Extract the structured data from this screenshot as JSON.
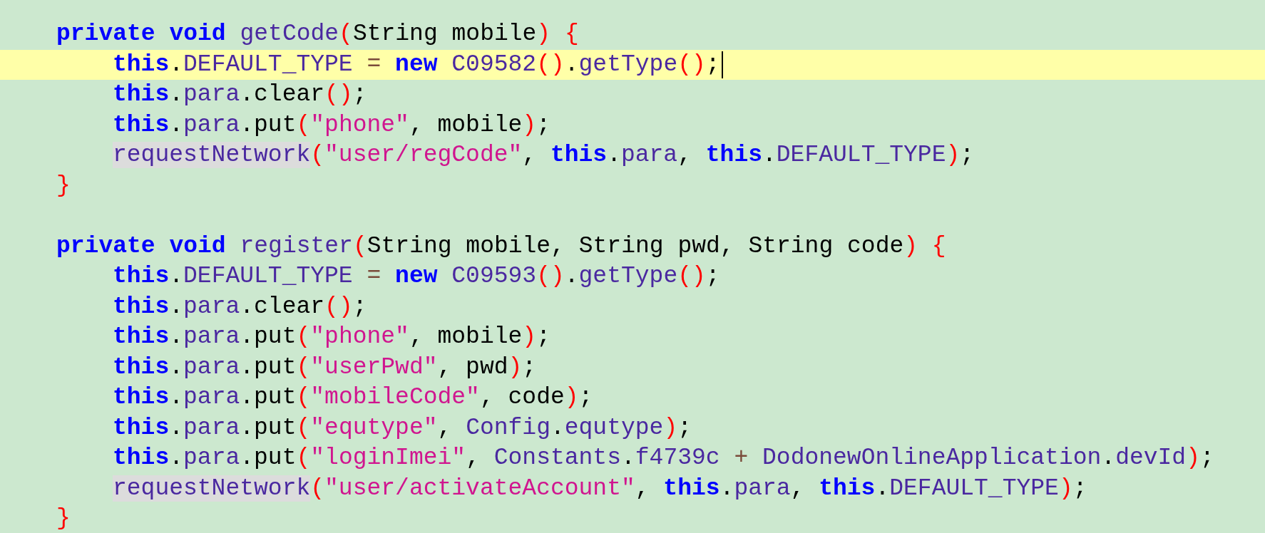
{
  "editor": {
    "methods": [
      {
        "signature": {
          "current": false,
          "tokens": [
            {
              "kind": "keyword",
              "text": "private "
            },
            {
              "kind": "keyword",
              "text": "void "
            },
            {
              "kind": "member",
              "text": "getCode"
            },
            {
              "kind": "paren",
              "text": "("
            },
            {
              "kind": "plain",
              "text": "String mobile"
            },
            {
              "kind": "paren",
              "text": ")"
            },
            {
              "kind": "paren",
              "text": " {"
            }
          ]
        },
        "body": [
          {
            "current": true,
            "tokens": [
              {
                "kind": "keyword",
                "text": "this"
              },
              {
                "kind": "plain",
                "text": "."
              },
              {
                "kind": "member",
                "text": "DEFAULT_TYPE"
              },
              {
                "kind": "operator",
                "text": " = "
              },
              {
                "kind": "keyword",
                "text": "new "
              },
              {
                "kind": "member",
                "text": "C09582"
              },
              {
                "kind": "paren",
                "text": "()"
              },
              {
                "kind": "plain",
                "text": "."
              },
              {
                "kind": "member",
                "text": "getType"
              },
              {
                "kind": "paren",
                "text": "()"
              },
              {
                "kind": "plain",
                "text": ";"
              }
            ]
          },
          {
            "current": false,
            "tokens": [
              {
                "kind": "keyword",
                "text": "this"
              },
              {
                "kind": "plain",
                "text": "."
              },
              {
                "kind": "member",
                "text": "para"
              },
              {
                "kind": "plain",
                "text": ".clear"
              },
              {
                "kind": "paren",
                "text": "()"
              },
              {
                "kind": "plain",
                "text": ";"
              }
            ]
          },
          {
            "current": false,
            "tokens": [
              {
                "kind": "keyword",
                "text": "this"
              },
              {
                "kind": "plain",
                "text": "."
              },
              {
                "kind": "member",
                "text": "para"
              },
              {
                "kind": "plain",
                "text": ".put"
              },
              {
                "kind": "paren",
                "text": "("
              },
              {
                "kind": "string",
                "text": "\"phone\""
              },
              {
                "kind": "plain",
                "text": ", mobile"
              },
              {
                "kind": "paren",
                "text": ")"
              },
              {
                "kind": "plain",
                "text": ";"
              }
            ]
          },
          {
            "current": false,
            "tokens": [
              {
                "kind": "reference",
                "text": "requestNetwork"
              },
              {
                "kind": "paren",
                "text": "("
              },
              {
                "kind": "string",
                "text": "\"user/regCode\""
              },
              {
                "kind": "plain",
                "text": ", "
              },
              {
                "kind": "keyword",
                "text": "this"
              },
              {
                "kind": "plain",
                "text": "."
              },
              {
                "kind": "member",
                "text": "para"
              },
              {
                "kind": "plain",
                "text": ", "
              },
              {
                "kind": "keyword",
                "text": "this"
              },
              {
                "kind": "plain",
                "text": "."
              },
              {
                "kind": "member",
                "text": "DEFAULT_TYPE"
              },
              {
                "kind": "paren",
                "text": ")"
              },
              {
                "kind": "plain",
                "text": ";"
              }
            ]
          }
        ],
        "closing": {
          "current": false,
          "tokens": [
            {
              "kind": "paren",
              "text": "}"
            }
          ]
        }
      },
      {
        "signature": {
          "current": false,
          "tokens": [
            {
              "kind": "keyword",
              "text": "private "
            },
            {
              "kind": "keyword",
              "text": "void "
            },
            {
              "kind": "member",
              "text": "register"
            },
            {
              "kind": "paren",
              "text": "("
            },
            {
              "kind": "plain",
              "text": "String mobile, String pwd, String code"
            },
            {
              "kind": "paren",
              "text": ")"
            },
            {
              "kind": "paren",
              "text": " {"
            }
          ]
        },
        "body": [
          {
            "current": false,
            "tokens": [
              {
                "kind": "keyword",
                "text": "this"
              },
              {
                "kind": "plain",
                "text": "."
              },
              {
                "kind": "member",
                "text": "DEFAULT_TYPE"
              },
              {
                "kind": "operator",
                "text": " = "
              },
              {
                "kind": "keyword",
                "text": "new "
              },
              {
                "kind": "member",
                "text": "C09593"
              },
              {
                "kind": "paren",
                "text": "()"
              },
              {
                "kind": "plain",
                "text": "."
              },
              {
                "kind": "member",
                "text": "getType"
              },
              {
                "kind": "paren",
                "text": "()"
              },
              {
                "kind": "plain",
                "text": ";"
              }
            ]
          },
          {
            "current": false,
            "tokens": [
              {
                "kind": "keyword",
                "text": "this"
              },
              {
                "kind": "plain",
                "text": "."
              },
              {
                "kind": "member",
                "text": "para"
              },
              {
                "kind": "plain",
                "text": ".clear"
              },
              {
                "kind": "paren",
                "text": "()"
              },
              {
                "kind": "plain",
                "text": ";"
              }
            ]
          },
          {
            "current": false,
            "tokens": [
              {
                "kind": "keyword",
                "text": "this"
              },
              {
                "kind": "plain",
                "text": "."
              },
              {
                "kind": "member",
                "text": "para"
              },
              {
                "kind": "plain",
                "text": ".put"
              },
              {
                "kind": "paren",
                "text": "("
              },
              {
                "kind": "string",
                "text": "\"phone\""
              },
              {
                "kind": "plain",
                "text": ", mobile"
              },
              {
                "kind": "paren",
                "text": ")"
              },
              {
                "kind": "plain",
                "text": ";"
              }
            ]
          },
          {
            "current": false,
            "tokens": [
              {
                "kind": "keyword",
                "text": "this"
              },
              {
                "kind": "plain",
                "text": "."
              },
              {
                "kind": "member",
                "text": "para"
              },
              {
                "kind": "plain",
                "text": ".put"
              },
              {
                "kind": "paren",
                "text": "("
              },
              {
                "kind": "string",
                "text": "\"userPwd\""
              },
              {
                "kind": "plain",
                "text": ", pwd"
              },
              {
                "kind": "paren",
                "text": ")"
              },
              {
                "kind": "plain",
                "text": ";"
              }
            ]
          },
          {
            "current": false,
            "tokens": [
              {
                "kind": "keyword",
                "text": "this"
              },
              {
                "kind": "plain",
                "text": "."
              },
              {
                "kind": "member",
                "text": "para"
              },
              {
                "kind": "plain",
                "text": ".put"
              },
              {
                "kind": "paren",
                "text": "("
              },
              {
                "kind": "string",
                "text": "\"mobileCode\""
              },
              {
                "kind": "plain",
                "text": ", code"
              },
              {
                "kind": "paren",
                "text": ")"
              },
              {
                "kind": "plain",
                "text": ";"
              }
            ]
          },
          {
            "current": false,
            "tokens": [
              {
                "kind": "keyword",
                "text": "this"
              },
              {
                "kind": "plain",
                "text": "."
              },
              {
                "kind": "member",
                "text": "para"
              },
              {
                "kind": "plain",
                "text": ".put"
              },
              {
                "kind": "paren",
                "text": "("
              },
              {
                "kind": "string",
                "text": "\"equtype\""
              },
              {
                "kind": "plain",
                "text": ", "
              },
              {
                "kind": "member",
                "text": "Config"
              },
              {
                "kind": "plain",
                "text": "."
              },
              {
                "kind": "member",
                "text": "equtype"
              },
              {
                "kind": "paren",
                "text": ")"
              },
              {
                "kind": "plain",
                "text": ";"
              }
            ]
          },
          {
            "current": false,
            "tokens": [
              {
                "kind": "keyword",
                "text": "this"
              },
              {
                "kind": "plain",
                "text": "."
              },
              {
                "kind": "member",
                "text": "para"
              },
              {
                "kind": "plain",
                "text": ".put"
              },
              {
                "kind": "paren",
                "text": "("
              },
              {
                "kind": "string",
                "text": "\"loginImei\""
              },
              {
                "kind": "plain",
                "text": ", "
              },
              {
                "kind": "member",
                "text": "Constants"
              },
              {
                "kind": "plain",
                "text": "."
              },
              {
                "kind": "member",
                "text": "f4739c"
              },
              {
                "kind": "operator",
                "text": " + "
              },
              {
                "kind": "member",
                "text": "DodonewOnlineApplication"
              },
              {
                "kind": "plain",
                "text": "."
              },
              {
                "kind": "member",
                "text": "devId"
              },
              {
                "kind": "paren",
                "text": ")"
              },
              {
                "kind": "plain",
                "text": ";"
              }
            ]
          },
          {
            "current": false,
            "tokens": [
              {
                "kind": "reference",
                "text": "requestNetwork"
              },
              {
                "kind": "paren",
                "text": "("
              },
              {
                "kind": "string",
                "text": "\"user/activateAccount\""
              },
              {
                "kind": "plain",
                "text": ", "
              },
              {
                "kind": "keyword",
                "text": "this"
              },
              {
                "kind": "plain",
                "text": "."
              },
              {
                "kind": "member",
                "text": "para"
              },
              {
                "kind": "plain",
                "text": ", "
              },
              {
                "kind": "keyword",
                "text": "this"
              },
              {
                "kind": "plain",
                "text": "."
              },
              {
                "kind": "member",
                "text": "DEFAULT_TYPE"
              },
              {
                "kind": "paren",
                "text": ")"
              },
              {
                "kind": "plain",
                "text": ";"
              }
            ]
          }
        ],
        "closing": {
          "current": false,
          "tokens": [
            {
              "kind": "paren",
              "text": "}"
            }
          ]
        }
      }
    ]
  }
}
